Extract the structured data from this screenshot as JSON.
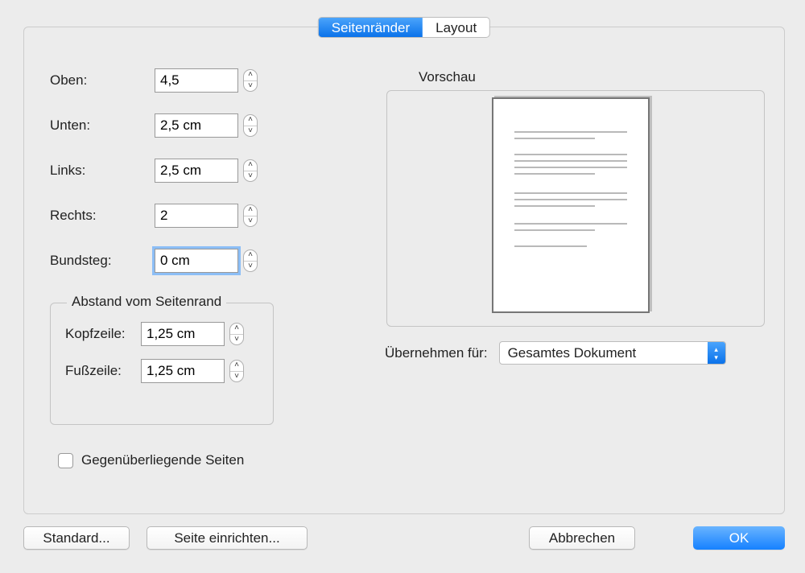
{
  "tabs": {
    "margins": "Seitenränder",
    "layout": "Layout"
  },
  "margins": {
    "top_label": "Oben:",
    "top_value": "4,5",
    "bottom_label": "Unten:",
    "bottom_value": "2,5 cm",
    "left_label": "Links:",
    "left_value": "2,5 cm",
    "right_label": "Rechts:",
    "right_value": "2",
    "gutter_label": "Bundsteg:",
    "gutter_value": "0 cm"
  },
  "from_edge": {
    "group_title": "Abstand vom Seitenrand",
    "header_label": "Kopfzeile:",
    "header_value": "1,25 cm",
    "footer_label": "Fußzeile:",
    "footer_value": "1,25 cm"
  },
  "mirror_label": "Gegenüberliegende Seiten",
  "preview_label": "Vorschau",
  "apply": {
    "label": "Übernehmen für:",
    "selected": "Gesamtes Dokument"
  },
  "buttons": {
    "standard": "Standard...",
    "page_setup": "Seite einrichten...",
    "cancel": "Abbrechen",
    "ok": "OK"
  }
}
